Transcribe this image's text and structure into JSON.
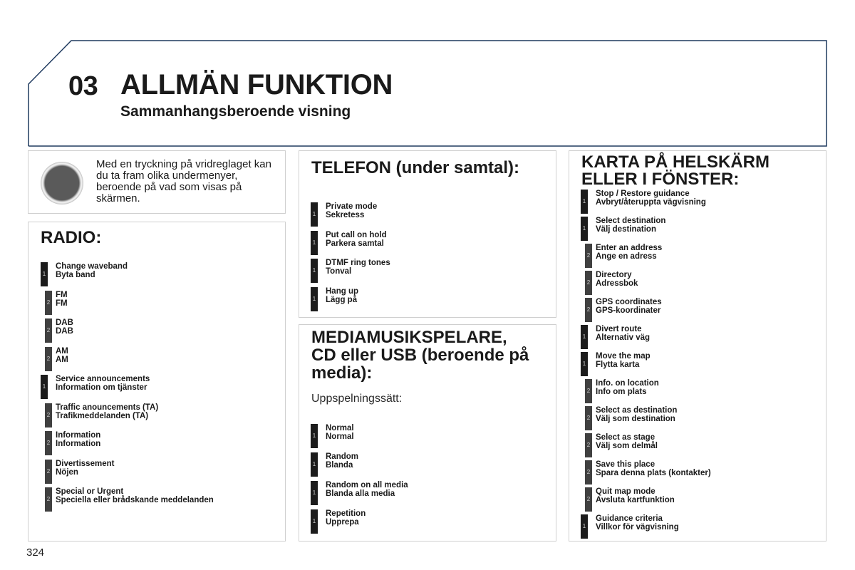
{
  "header": {
    "chapter_number": "03",
    "title": "ALLMÄN FUNKTION",
    "subtitle": "Sammanhangsberoende visning",
    "frame_color": "#1f3a5f"
  },
  "intro": {
    "icon": "rotary-knob-icon",
    "text": "Med en tryckning på vridreglaget kan du ta fram olika undermenyer, beroende på vad som visas på skärmen."
  },
  "radio": {
    "title": "RADIO:",
    "items": [
      {
        "level": "1",
        "en": "Change waveband",
        "sv": "Byta band"
      },
      {
        "level": "2",
        "en": "FM",
        "sv": "FM"
      },
      {
        "level": "2",
        "en": "DAB",
        "sv": "DAB"
      },
      {
        "level": "2",
        "en": "AM",
        "sv": "AM"
      },
      {
        "level": "1",
        "en": "Service announcements",
        "sv": "Information om tjänster"
      },
      {
        "level": "2",
        "en": "Traffic anouncements (TA)",
        "sv": "Trafikmeddelanden (TA)"
      },
      {
        "level": "2",
        "en": "Information",
        "sv": "Information"
      },
      {
        "level": "2",
        "en": "Divertissement",
        "sv": "Nöjen"
      },
      {
        "level": "2",
        "en": "Special or Urgent",
        "sv": "Speciella eller brådskande meddelanden"
      }
    ]
  },
  "telefon": {
    "title": "TELEFON (under samtal):",
    "items": [
      {
        "level": "1",
        "en": "Private mode",
        "sv": "Sekretess"
      },
      {
        "level": "1",
        "en": "Put call on hold",
        "sv": "Parkera samtal"
      },
      {
        "level": "1",
        "en": "DTMF ring tones",
        "sv": "Tonval"
      },
      {
        "level": "1",
        "en": "Hang up",
        "sv": "Lägg på"
      }
    ]
  },
  "media": {
    "title_lines": [
      "MEDIAMUSIKSPELARE,",
      "CD eller USB (beroende på",
      "media):"
    ],
    "sublabel": "Uppspelningssätt:",
    "items": [
      {
        "level": "1",
        "en": "Normal",
        "sv": "Normal"
      },
      {
        "level": "1",
        "en": "Random",
        "sv": "Blanda"
      },
      {
        "level": "1",
        "en": "Random on all media",
        "sv": "Blanda alla media"
      },
      {
        "level": "1",
        "en": "Repetition",
        "sv": "Upprepa"
      }
    ]
  },
  "karta": {
    "title_lines": [
      "KARTA PÅ HELSKÄRM",
      "ELLER I FÖNSTER:"
    ],
    "items": [
      {
        "level": "1",
        "en": "Stop / Restore guidance",
        "sv": "Avbryt/återuppta vägvisning"
      },
      {
        "level": "1",
        "en": "Select destination",
        "sv": "Välj destination"
      },
      {
        "level": "2",
        "en": "Enter an address",
        "sv": "Ange en adress"
      },
      {
        "level": "2",
        "en": "Directory",
        "sv": "Adressbok"
      },
      {
        "level": "2",
        "en": "GPS coordinates",
        "sv": "GPS-koordinater"
      },
      {
        "level": "1",
        "en": "Divert route",
        "sv": "Alternativ väg"
      },
      {
        "level": "1",
        "en": "Move the map",
        "sv": "Flytta karta"
      },
      {
        "level": "2",
        "en": "Info. on location",
        "sv": "Info om plats"
      },
      {
        "level": "2",
        "en": "Select as destination",
        "sv": "Välj som destination"
      },
      {
        "level": "2",
        "en": "Select as stage",
        "sv": "Välj som delmål"
      },
      {
        "level": "2",
        "en": "Save this place",
        "sv": "Spara denna plats (kontakter)"
      },
      {
        "level": "2",
        "en": "Quit map mode",
        "sv": "Avsluta kartfunktion"
      },
      {
        "level": "1",
        "en": "Guidance criteria",
        "sv": "Villkor för vägvisning"
      }
    ]
  },
  "page_number": "324"
}
